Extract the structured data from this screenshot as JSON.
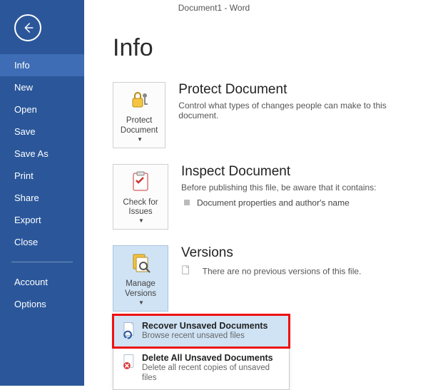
{
  "title": "Document1 - Word",
  "sidebar": {
    "items": [
      {
        "label": "Info",
        "active": true
      },
      {
        "label": "New"
      },
      {
        "label": "Open"
      },
      {
        "label": "Save"
      },
      {
        "label": "Save As"
      },
      {
        "label": "Print"
      },
      {
        "label": "Share"
      },
      {
        "label": "Export"
      },
      {
        "label": "Close"
      }
    ],
    "footer": [
      {
        "label": "Account"
      },
      {
        "label": "Options"
      }
    ]
  },
  "page": {
    "heading": "Info",
    "protect": {
      "tile": "Protect Document",
      "heading": "Protect Document",
      "desc": "Control what types of changes people can make to this document."
    },
    "inspect": {
      "tile": "Check for Issues",
      "heading": "Inspect Document",
      "desc": "Before publishing this file, be aware that it contains:",
      "item1": "Document properties and author's name"
    },
    "versions": {
      "tile": "Manage Versions",
      "heading": "Versions",
      "none": "There are no previous versions of this file."
    },
    "menu": {
      "recover": {
        "title": "Recover Unsaved Documents",
        "desc": "Browse recent unsaved files"
      },
      "delete": {
        "title": "Delete All Unsaved Documents",
        "desc": "Delete all recent copies of unsaved files"
      }
    }
  }
}
